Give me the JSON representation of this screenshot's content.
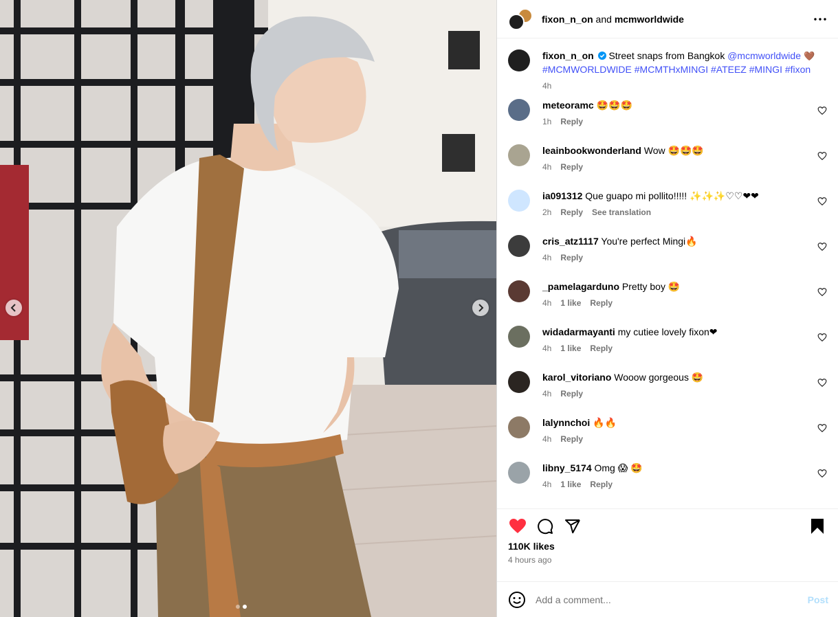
{
  "post": {
    "header": {
      "author": "fixon_n_on",
      "connector": " and ",
      "coauthor": "mcmworldwide",
      "more_icon": "more-horizontal-icon"
    },
    "caption": {
      "username": "fixon_n_on",
      "verified_icon": "verified-badge-icon",
      "text": " Street snaps from Bangkok ",
      "mention": "@mcmworldwide",
      "emoji": " 🤎",
      "hashtags": "#MCMWORLDWIDE #MCMTHxMINGI #ATEEZ #MINGI #fixon",
      "time": "4h"
    },
    "comments": [
      {
        "username": "meteoramc",
        "text": " 🤩🤩🤩",
        "time": "1h",
        "likes": "",
        "reply": "Reply",
        "translate": "",
        "avatar_color": "#5a6d88"
      },
      {
        "username": "leainbookwonderland",
        "text": " Wow 🤩🤩🤩",
        "time": "4h",
        "likes": "",
        "reply": "Reply",
        "translate": "",
        "avatar_color": "#a9a491"
      },
      {
        "username": "ia091312",
        "text": " Que guapo mi pollito!!!!! ✨✨✨♡♡❤❤",
        "time": "2h",
        "likes": "",
        "reply": "Reply",
        "translate": "See translation",
        "avatar_color": "#cfe6ff"
      },
      {
        "username": "cris_atz1117",
        "text": " You're perfect Mingi🔥",
        "time": "4h",
        "likes": "",
        "reply": "Reply",
        "translate": "",
        "avatar_color": "#3c3c3c"
      },
      {
        "username": "_pamelagarduno",
        "text": " Pretty boy 🤩",
        "time": "4h",
        "likes": "1 like",
        "reply": "Reply",
        "translate": "",
        "avatar_color": "#5a3a33"
      },
      {
        "username": "widadarmayanti",
        "text": " my cutiee lovely fixon❤",
        "time": "4h",
        "likes": "1 like",
        "reply": "Reply",
        "translate": "",
        "avatar_color": "#6b6f60"
      },
      {
        "username": "karol_vitoriano",
        "text": " Wooow gorgeous 🤩",
        "time": "4h",
        "likes": "",
        "reply": "Reply",
        "translate": "",
        "avatar_color": "#2b2521"
      },
      {
        "username": "lalynnchoi",
        "text": " 🔥🔥",
        "time": "4h",
        "likes": "",
        "reply": "Reply",
        "translate": "",
        "avatar_color": "#8d7a66"
      },
      {
        "username": "libny_5174",
        "text": " Omg 😱 🤩",
        "time": "4h",
        "likes": "1 like",
        "reply": "Reply",
        "translate": "",
        "avatar_color": "#9aa3a8"
      }
    ],
    "actions": {
      "like_icon": "heart-filled-icon",
      "comment_icon": "comment-bubble-icon",
      "share_icon": "share-send-icon",
      "save_icon": "bookmark-filled-icon",
      "likes": "110K likes",
      "ago": "4 hours ago"
    },
    "add_comment": {
      "emoji_icon": "emoji-smile-icon",
      "placeholder": "Add a comment...",
      "post_label": "Post"
    },
    "media": {
      "prev_icon": "chevron-left-icon",
      "next_icon": "chevron-right-icon",
      "slide_count": 2,
      "active_slide": 2
    },
    "colors": {
      "like_red": "#ff3040",
      "link_blue": "#4150f7",
      "meta_gray": "#737373",
      "post_disabled": "#b2dffc"
    }
  }
}
